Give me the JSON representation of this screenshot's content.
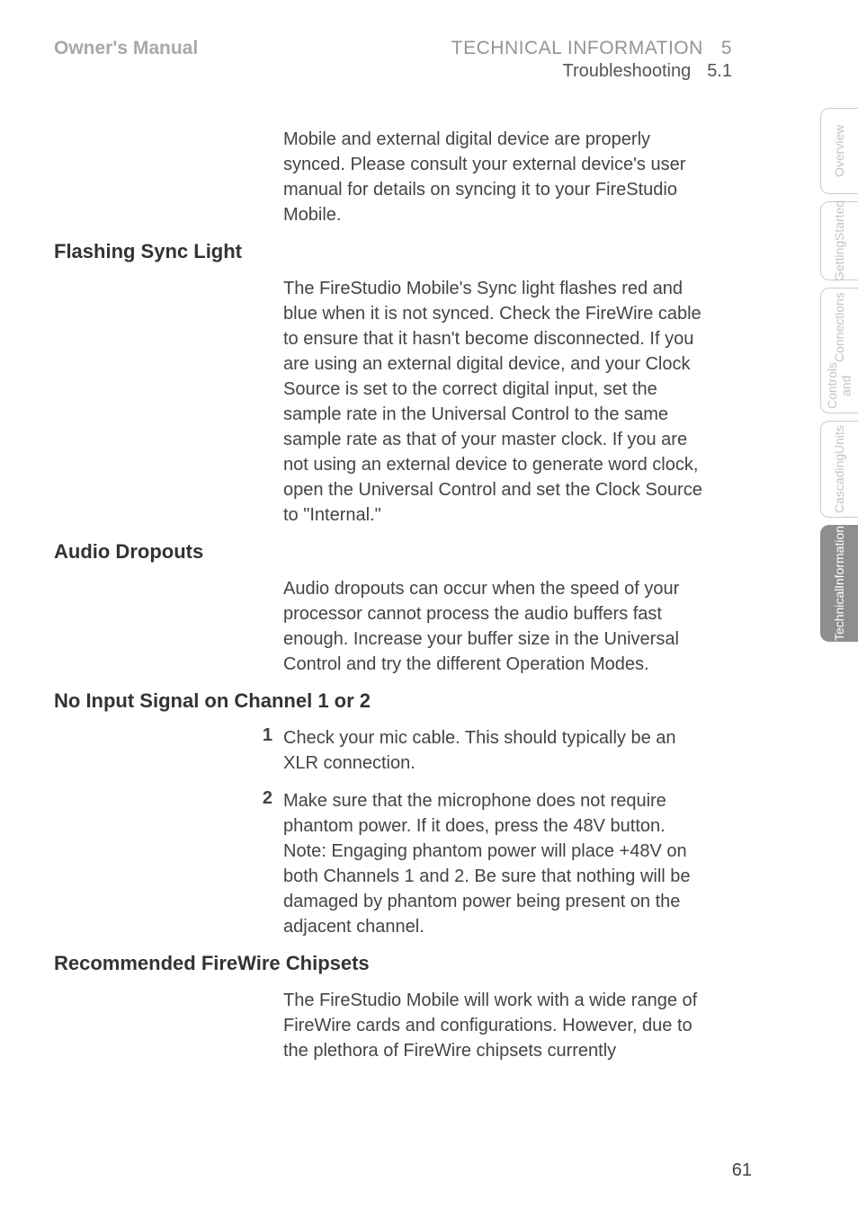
{
  "header": {
    "owners_manual": "Owner's Manual",
    "section_title": "TECHNICAL INFORMATION",
    "section_num": "5",
    "subsection_title": "Troubleshooting",
    "subsection_num": "5.1"
  },
  "intro_continuation": "Mobile and external digital device are properly synced. Please consult your external device's user manual for details on syncing it to your FireStudio Mobile.",
  "sections": {
    "flashing_sync": {
      "heading": "Flashing Sync Light",
      "body": "The FireStudio Mobile's Sync light flashes red and blue when it is not synced. Check the FireWire cable to ensure that it hasn't become disconnected. If you are using an external digital device, and your Clock Source is set to the correct digital input, set the sample rate in the Universal Control to the same sample rate as that of your master clock. If you are not using an external device to generate word clock, open the Universal Control and set the Clock Source to \"Internal.\""
    },
    "audio_dropouts": {
      "heading": "Audio Dropouts",
      "body": "Audio dropouts can occur when the speed of your processor cannot process the audio buffers fast enough. Increase your buffer size in the Universal Control and try the different Operation Modes."
    },
    "no_input": {
      "heading": "No Input Signal on Channel 1 or 2",
      "items": [
        {
          "num": "1",
          "text": "Check your mic cable. This should typically be an XLR connection."
        },
        {
          "num": "2",
          "text": "Make sure that the microphone does not require phantom power. If it does, press the 48V button. Note: Engaging phantom power will place +48V on both Channels 1 and 2. Be sure that nothing will be damaged by phantom power being present on the adjacent channel."
        }
      ]
    },
    "firewire_chipsets": {
      "heading": "Recommended FireWire Chipsets",
      "body": "The FireStudio Mobile will work with a wide range of FireWire cards and configurations. However, due to the plethora of FireWire chipsets currently"
    }
  },
  "page_number": "61",
  "tabs": [
    {
      "line1": "Overview",
      "line2": "",
      "active": false
    },
    {
      "line1": "Getting",
      "line2": "Started",
      "active": false
    },
    {
      "line1": "Controls and",
      "line2": "Connections",
      "active": false
    },
    {
      "line1": "Cascading",
      "line2": "Units",
      "active": false
    },
    {
      "line1": "Technical",
      "line2": "Information",
      "active": true
    }
  ]
}
